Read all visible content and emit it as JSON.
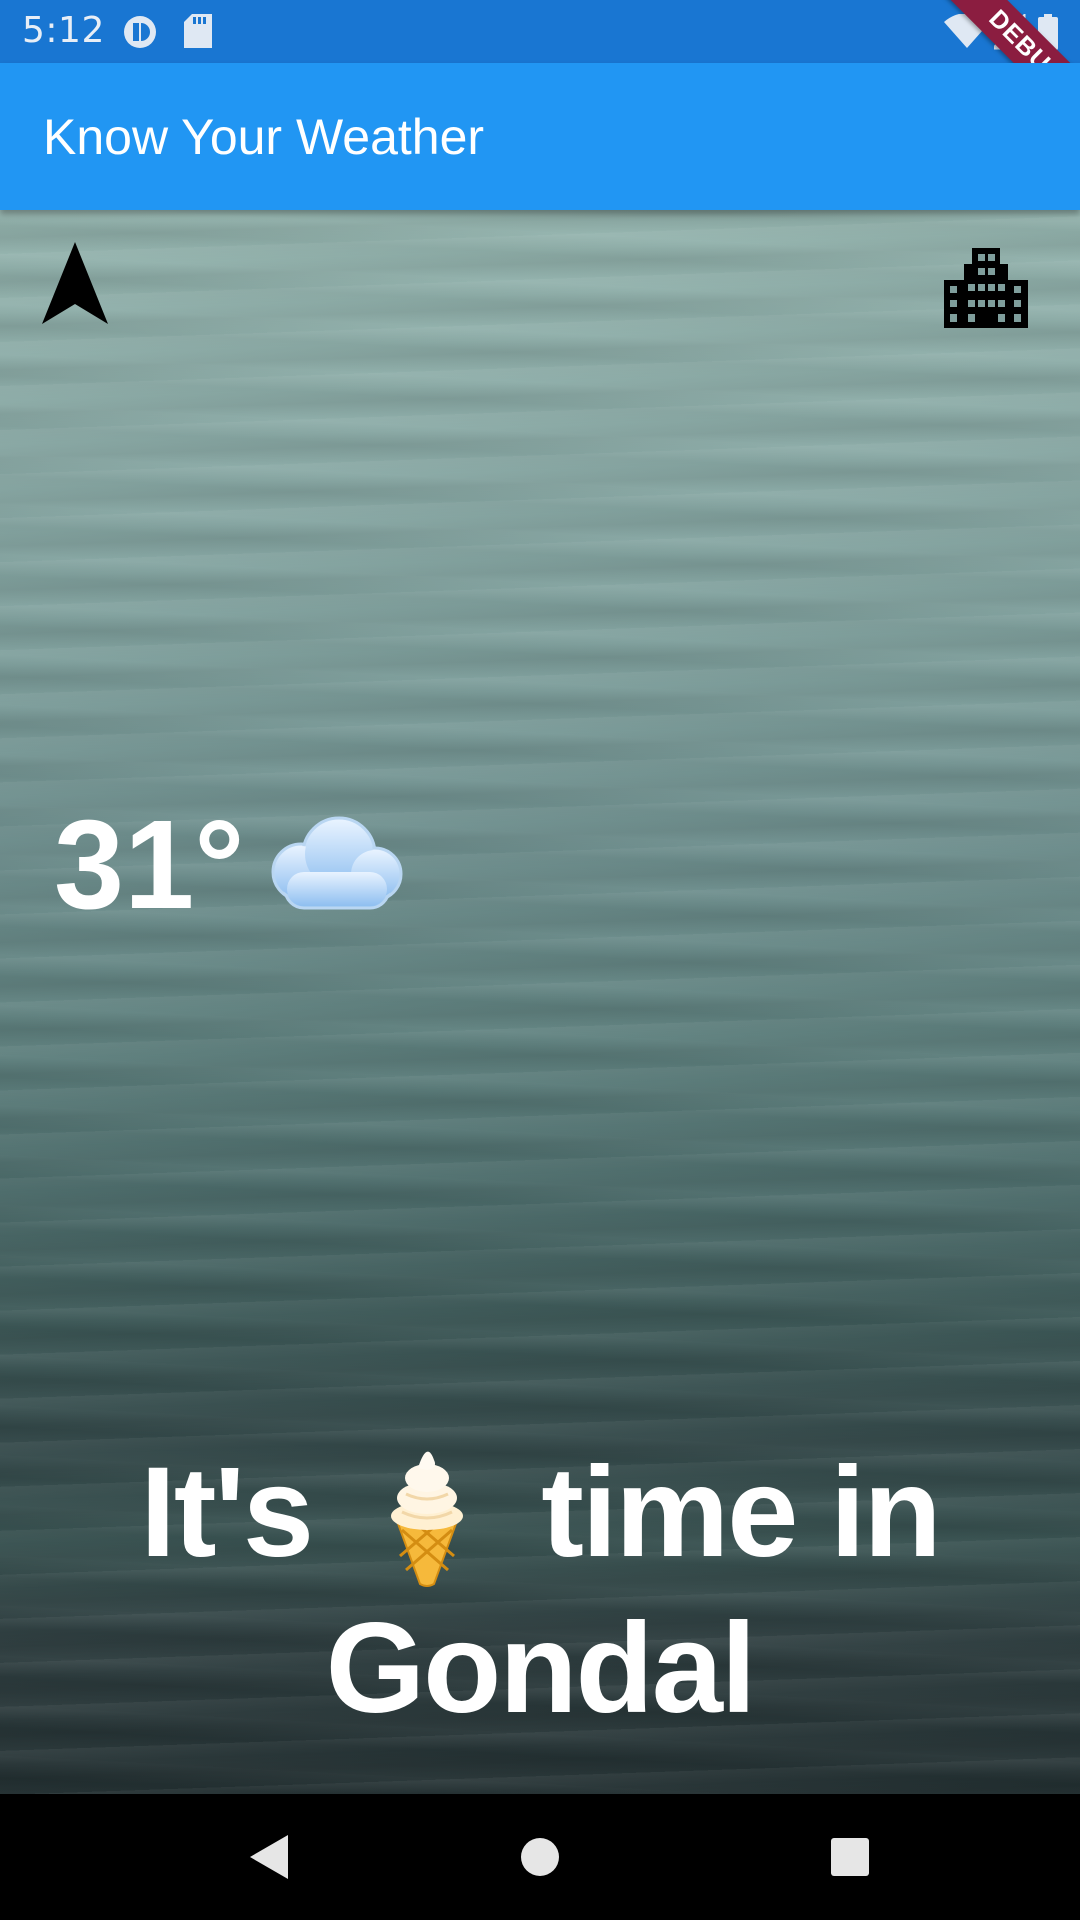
{
  "status_bar": {
    "time": "5:12",
    "debug_label": "DEBUG",
    "background_color": "#1976D2"
  },
  "app_bar": {
    "title": "Know Your Weather",
    "color": "#2196F3"
  },
  "weather": {
    "temperature": "31°",
    "condition_icon": "cloud-icon",
    "message_prefix": "It's",
    "message_icon": "ice-cream-icon",
    "message_suffix": "time in",
    "city": "Gondal"
  },
  "actions": {
    "location_icon": "navigation-arrow-icon",
    "city_icon": "location-city-icon"
  },
  "system_nav": {
    "back_icon": "back-triangle-icon",
    "home_icon": "home-circle-icon",
    "recents_icon": "recents-square-icon"
  }
}
